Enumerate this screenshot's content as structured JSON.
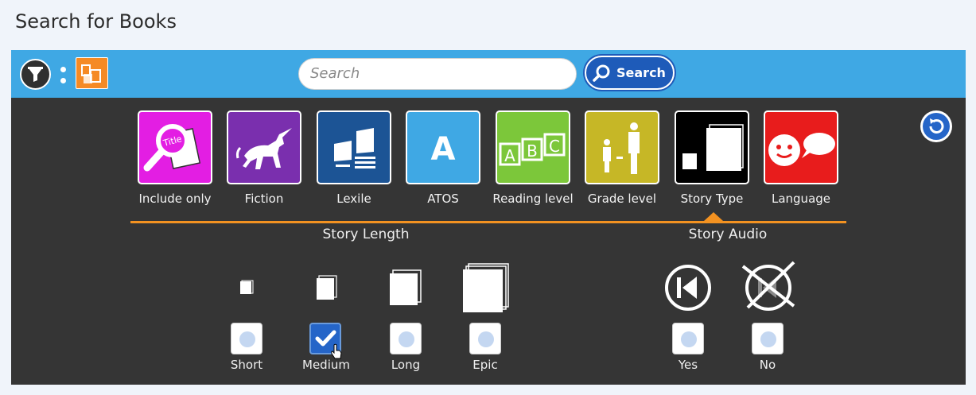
{
  "page": {
    "title": "Search for Books"
  },
  "toolbar": {
    "search_placeholder": "Search",
    "search_button": "Search"
  },
  "categories": [
    {
      "label": "Include only",
      "color": "#e31ee3",
      "icon": "magnifier-title-icon"
    },
    {
      "label": "Fiction",
      "color": "#7a2fae",
      "icon": "unicorn-icon"
    },
    {
      "label": "Lexile",
      "color": "#1c5495",
      "icon": "books-text-icon"
    },
    {
      "label": "ATOS",
      "color": "#3fa8e4",
      "icon": "letter-a-icon"
    },
    {
      "label": "Reading level",
      "color": "#7cc73a",
      "icon": "abc-blocks-icon"
    },
    {
      "label": "Grade level",
      "color": "#c6b726",
      "icon": "child-adult-icon"
    },
    {
      "label": "Story Type",
      "color": "#000000",
      "icon": "pages-icon",
      "selected": true
    },
    {
      "label": "Language",
      "color": "#e81c1c",
      "icon": "speech-face-icon"
    }
  ],
  "filters": {
    "story_length": {
      "title": "Story Length",
      "options": [
        {
          "label": "Short",
          "checked": false
        },
        {
          "label": "Medium",
          "checked": true
        },
        {
          "label": "Long",
          "checked": false
        },
        {
          "label": "Epic",
          "checked": false
        }
      ]
    },
    "story_audio": {
      "title": "Story Audio",
      "options": [
        {
          "label": "Yes",
          "checked": false
        },
        {
          "label": "No",
          "checked": false
        }
      ]
    }
  },
  "colors": {
    "toolbar": "#3fa8e4",
    "panel": "#353535",
    "accent": "#f39221",
    "search_button": "#1e5bb9"
  }
}
